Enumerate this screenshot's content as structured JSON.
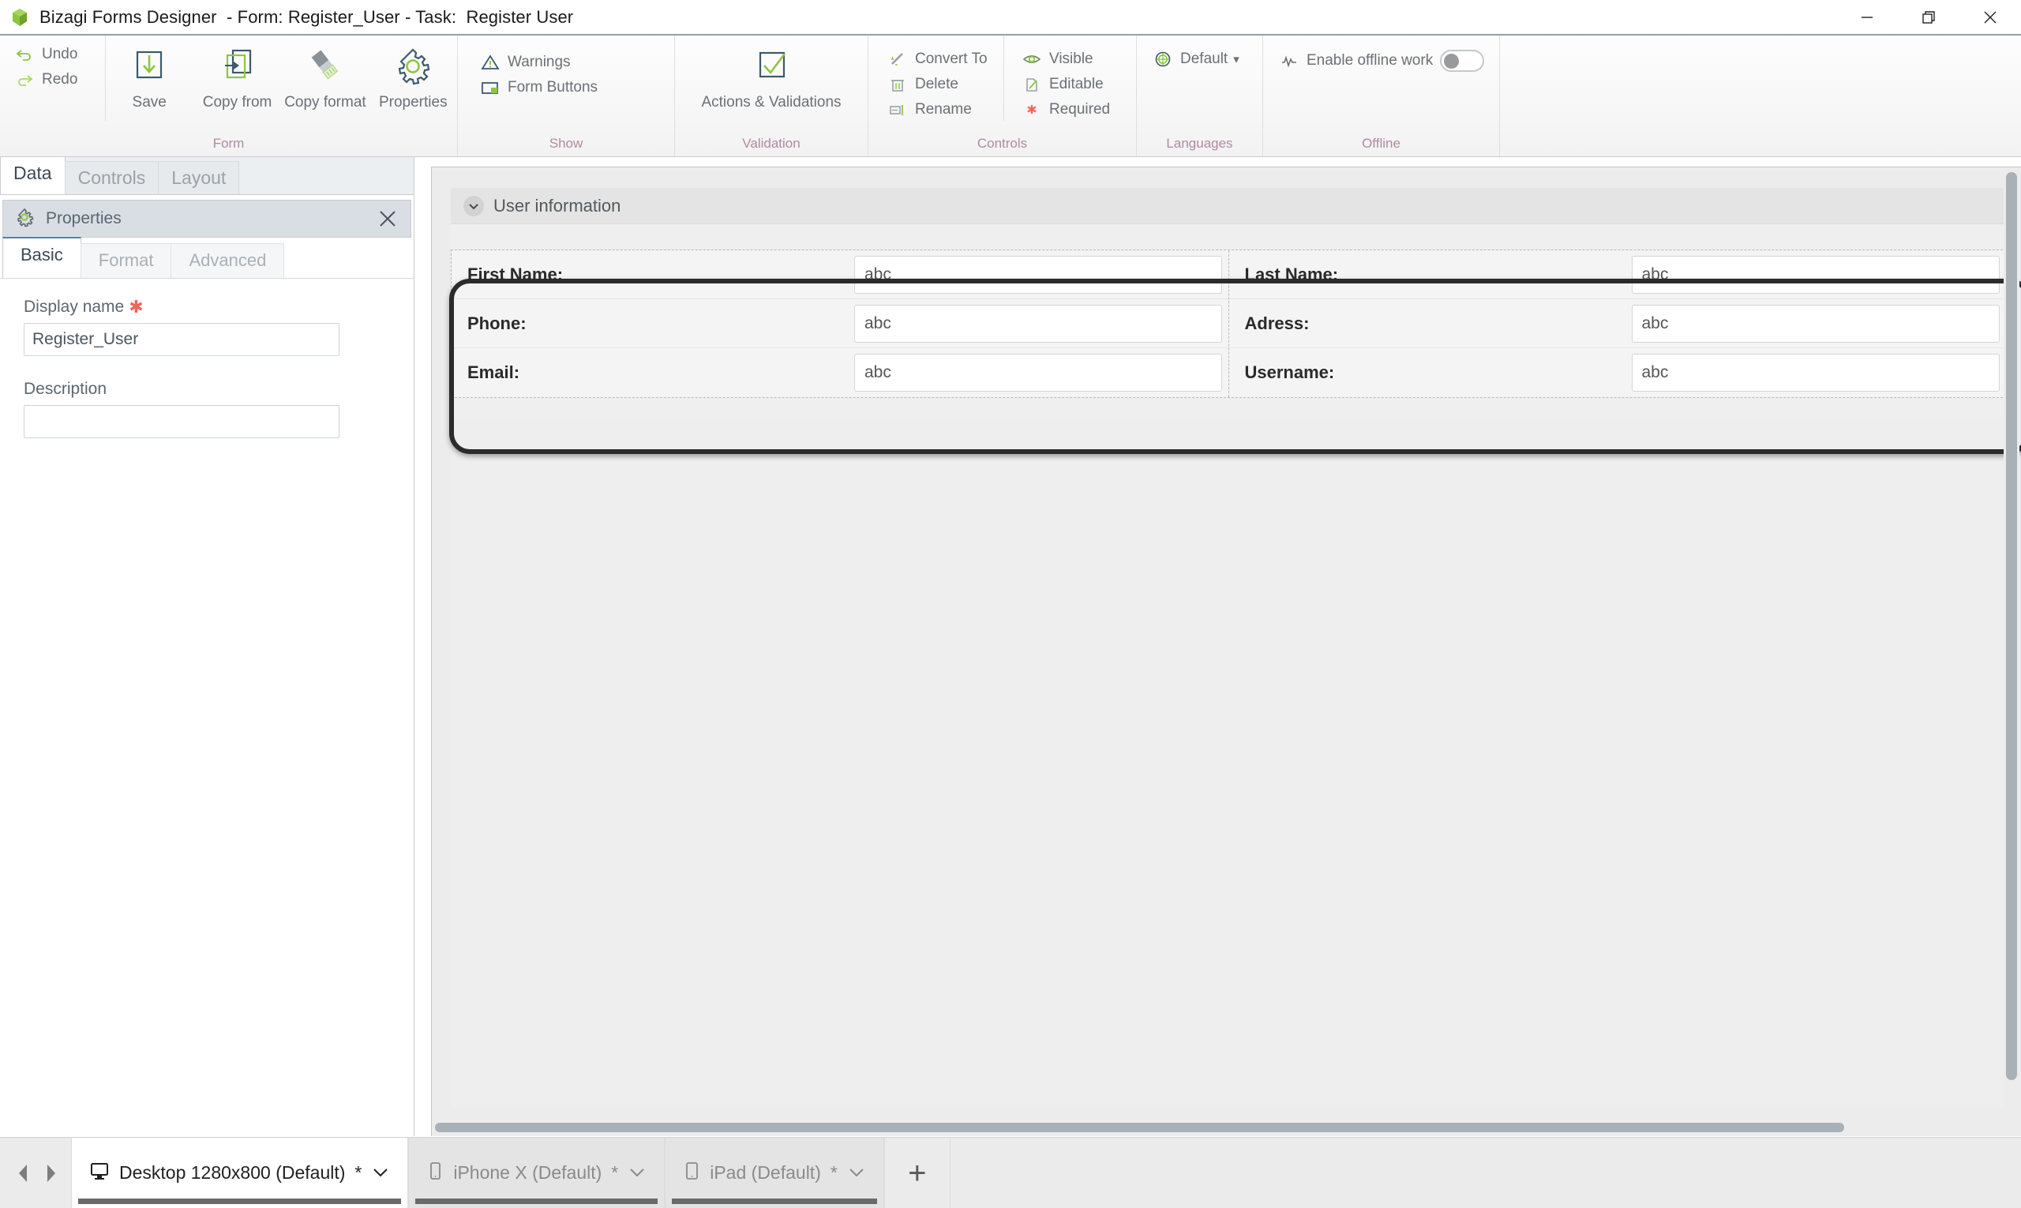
{
  "window": {
    "title": "Bizagi Forms Designer  - Form: Register_User - Task:  Register User",
    "logo_icon": "bizagi-logo-icon",
    "minimize_icon": "minimize-icon",
    "restore_icon": "restore-icon",
    "close_icon": "close-icon"
  },
  "ribbon": {
    "groups": [
      {
        "label": "Form",
        "small_items": [
          {
            "label": "Undo",
            "icon": "undo-icon"
          },
          {
            "label": "Redo",
            "icon": "redo-icon"
          }
        ],
        "big_items": [
          {
            "label": "Save",
            "icon": "save-icon"
          },
          {
            "label": "Copy from",
            "icon": "copy-from-icon"
          },
          {
            "label": "Copy format",
            "icon": "copy-format-icon"
          },
          {
            "label": "Properties",
            "icon": "properties-gear-icon"
          }
        ]
      },
      {
        "label": "Show",
        "small_items": [
          {
            "label": "Warnings",
            "icon": "warning-triangle-icon"
          },
          {
            "label": "Form Buttons",
            "icon": "form-buttons-icon"
          }
        ]
      },
      {
        "label": "Validation",
        "big_items": [
          {
            "label": "Actions & Validations",
            "icon": "checkbox-check-icon"
          }
        ]
      },
      {
        "label": "Controls",
        "small_items_a": [
          {
            "label": "Convert To",
            "icon": "magic-wand-icon"
          },
          {
            "label": "Delete",
            "icon": "trash-icon"
          },
          {
            "label": "Rename",
            "icon": "rename-icon"
          }
        ],
        "small_items_b": [
          {
            "label": "Visible",
            "icon": "eye-icon"
          },
          {
            "label": "Editable",
            "icon": "editable-pencil-icon"
          },
          {
            "label": "Required",
            "icon": "required-asterisk-icon"
          }
        ]
      },
      {
        "label": "Languages",
        "small_items": [
          {
            "label": "Default",
            "icon": "globe-icon",
            "caret": "▾"
          }
        ]
      },
      {
        "label": "Offline",
        "small_items": [
          {
            "label": "Enable offline work",
            "icon": "offline-signal-icon"
          }
        ],
        "toggle_state": "off"
      }
    ]
  },
  "left_panel": {
    "tabs": [
      {
        "label": "Data",
        "active": true
      },
      {
        "label": "Controls",
        "active": false
      },
      {
        "label": "Layout",
        "active": false
      }
    ],
    "properties_panel": {
      "icon": "gear-icon",
      "title": "Properties",
      "close_icon": "close-icon",
      "tabs": [
        {
          "label": "Basic",
          "active": true
        },
        {
          "label": "Format",
          "active": false
        },
        {
          "label": "Advanced",
          "active": false
        }
      ],
      "fields": [
        {
          "label": "Display name",
          "required": true,
          "value": "Register_User",
          "placeholder": ""
        },
        {
          "label": "Description",
          "required": false,
          "value": "",
          "placeholder": ""
        }
      ]
    }
  },
  "canvas": {
    "section": {
      "collapse_icon": "chevron-down-icon",
      "title": "User information"
    },
    "form_rows": [
      {
        "left_label": "First Name:",
        "left_value": "abc",
        "right_label": "Last Name:",
        "right_value": "abc"
      },
      {
        "left_label": "Phone:",
        "left_value": "abc",
        "right_label": "Adress:",
        "right_value": "abc"
      },
      {
        "left_label": "Email:",
        "left_value": "abc",
        "right_label": "Username:",
        "right_value": "abc"
      }
    ],
    "selection_highlight": true
  },
  "bottom_bar": {
    "prev_icon": "arrow-left-icon",
    "next_icon": "arrow-right-icon",
    "tabs": [
      {
        "label": "Desktop 1280x800 (Default)",
        "modified": "*",
        "caret": "⌄",
        "icon": "desktop-icon",
        "active": true
      },
      {
        "label": "iPhone X (Default)",
        "modified": "*",
        "caret": "⌄",
        "icon": "phone-icon",
        "active": false
      },
      {
        "label": "iPad (Default)",
        "modified": "*",
        "caret": "⌄",
        "icon": "tablet-icon",
        "active": false
      }
    ],
    "add_label": "+"
  },
  "colors": {
    "accent_green": "#8cc63f",
    "accent_blue": "#3d5a6c",
    "required_red": "#f2645a",
    "group_label": "#b08aa0",
    "selection_ring": "#2b2b2b"
  }
}
